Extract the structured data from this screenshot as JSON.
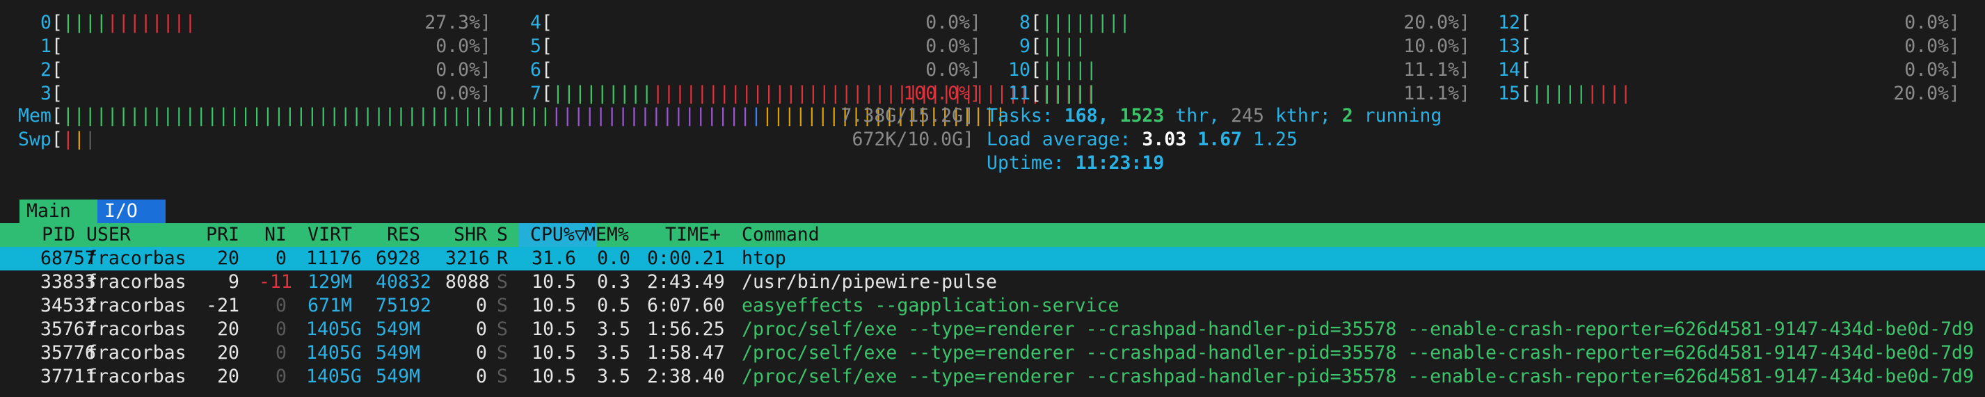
{
  "cpu_meters": [
    {
      "id": "0",
      "pct": "27.3%]",
      "bars_green": "||||",
      "bars_red": "||||||||"
    },
    {
      "id": "1",
      "pct": "0.0%]",
      "bars_green": "",
      "bars_red": ""
    },
    {
      "id": "2",
      "pct": "0.0%]",
      "bars_green": "",
      "bars_red": ""
    },
    {
      "id": "3",
      "pct": "0.0%]",
      "bars_green": "",
      "bars_red": ""
    },
    {
      "id": "4",
      "pct": "0.0%]",
      "bars_green": "",
      "bars_red": ""
    },
    {
      "id": "5",
      "pct": "0.0%]",
      "bars_green": "",
      "bars_red": ""
    },
    {
      "id": "6",
      "pct": "0.0%]",
      "bars_green": "",
      "bars_red": ""
    },
    {
      "id": "7",
      "pct": "100.0%]",
      "bars_green": "|||||||||",
      "bars_red": "||||||||||||||||||||||||||||||||||||||||"
    },
    {
      "id": "8",
      "pct": "20.0%]",
      "bars_green": "||||||||",
      "bars_red": ""
    },
    {
      "id": "9",
      "pct": "10.0%]",
      "bars_green": "||||",
      "bars_red": ""
    },
    {
      "id": "10",
      "pct": "11.1%]",
      "bars_green": "|||||",
      "bars_red": ""
    },
    {
      "id": "11",
      "pct": "11.1%]",
      "bars_green": "|||||",
      "bars_red": ""
    },
    {
      "id": "12",
      "pct": "0.0%]",
      "bars_green": "",
      "bars_red": ""
    },
    {
      "id": "13",
      "pct": "0.0%]",
      "bars_green": "",
      "bars_red": ""
    },
    {
      "id": "14",
      "pct": "0.0%]",
      "bars_green": "",
      "bars_red": ""
    },
    {
      "id": "15",
      "pct": "20.0%]",
      "bars_green": "|||||",
      "bars_red": "||||"
    }
  ],
  "mem": {
    "label": "Mem",
    "green": "||||||||||||||||||||||||||||||||||||||||||||",
    "blue": "||||||||||||||||||",
    "yellow": "||||||||||||||||||||||",
    "value": "7.38G/15.2G]"
  },
  "swp": {
    "label": "Swp",
    "value": "672K/10.0G]"
  },
  "tasks": {
    "label": "Tasks:",
    "tasks": "168,",
    "threads": "1523",
    "thr": "thr,",
    "kthreads": "245",
    "kthr": "kthr;",
    "running": "2",
    "running_label": "running"
  },
  "load": {
    "label": "Load average:",
    "l1": "3.03",
    "l5": "1.67",
    "l15": "1.25"
  },
  "uptime": {
    "label": "Uptime:",
    "value": "11:23:19"
  },
  "tabs": {
    "main": "Main",
    "io": "I/O"
  },
  "columns": {
    "pid": "PID",
    "user": "USER",
    "pri": "PRI",
    "ni": "NI",
    "virt": "VIRT",
    "res": "RES",
    "shr": "SHR",
    "s": "S",
    "cpu": "CPU%▽",
    "mem": "MEM%",
    "time": "TIME+",
    "cmd": "Command"
  },
  "processes": [
    {
      "pid": "68757",
      "user": "fracorbas",
      "pri": "20",
      "ni": "0",
      "virt": "11176",
      "res": "6928",
      "shr": "3216",
      "s": "R",
      "cpu": "31.6",
      "mem": "0.0",
      "time": "0:00.21",
      "cmd": "htop"
    },
    {
      "pid": "33833",
      "user": "fracorbas",
      "pri": "9",
      "ni": "-11",
      "virt": "129M",
      "res": "40832",
      "shr": "8088",
      "s": "S",
      "cpu": "10.5",
      "mem": "0.3",
      "time": "2:43.49",
      "cmd": "/usr/bin/pipewire-pulse"
    },
    {
      "pid": "34532",
      "user": "fracorbas",
      "pri": "-21",
      "ni": "0",
      "virt": "671M",
      "res": "75192",
      "shr": "0",
      "s": "S",
      "cpu": "10.5",
      "mem": "0.5",
      "time": "6:07.60",
      "cmd": "easyeffects --gapplication-service"
    },
    {
      "pid": "35767",
      "user": "fracorbas",
      "pri": "20",
      "ni": "0",
      "virt": "1405G",
      "res": "549M",
      "shr": "0",
      "s": "S",
      "cpu": "10.5",
      "mem": "3.5",
      "time": "1:56.25",
      "cmd": "/proc/self/exe --type=renderer --crashpad-handler-pid=35578 --enable-crash-reporter=626d4581-9147-434d-be0d-7d9"
    },
    {
      "pid": "35776",
      "user": "fracorbas",
      "pri": "20",
      "ni": "0",
      "virt": "1405G",
      "res": "549M",
      "shr": "0",
      "s": "S",
      "cpu": "10.5",
      "mem": "3.5",
      "time": "1:58.47",
      "cmd": "/proc/self/exe --type=renderer --crashpad-handler-pid=35578 --enable-crash-reporter=626d4581-9147-434d-be0d-7d9"
    },
    {
      "pid": "37711",
      "user": "fracorbas",
      "pri": "20",
      "ni": "0",
      "virt": "1405G",
      "res": "549M",
      "shr": "0",
      "s": "S",
      "cpu": "10.5",
      "mem": "3.5",
      "time": "2:38.40",
      "cmd": "/proc/self/exe --type=renderer --crashpad-handler-pid=35578 --enable-crash-reporter=626d4581-9147-434d-be0d-7d9"
    }
  ]
}
